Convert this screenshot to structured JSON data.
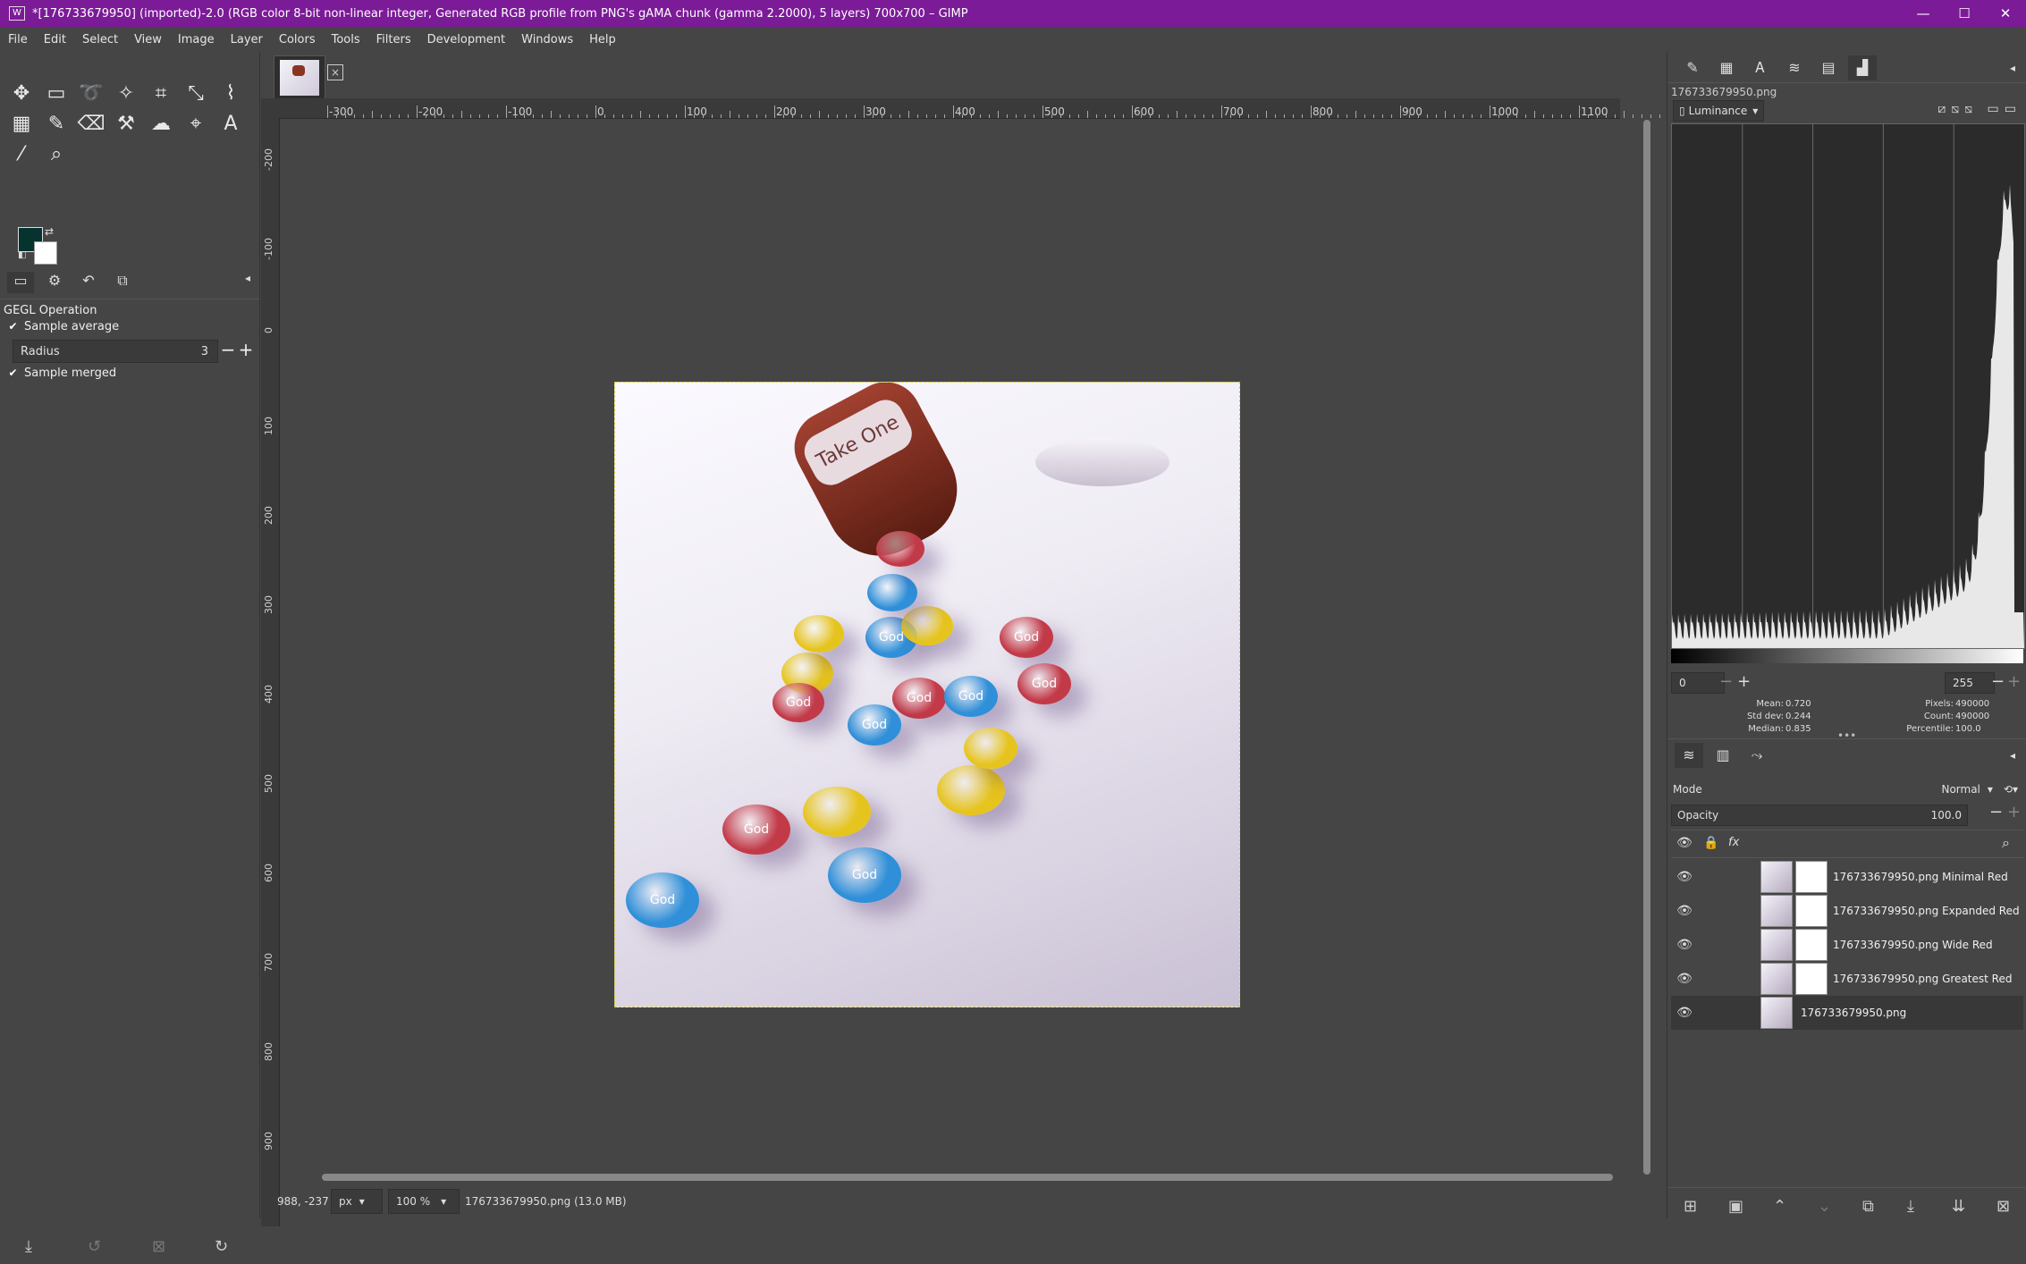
{
  "window": {
    "title": "*[176733679950] (imported)-2.0 (RGB color 8-bit non-linear integer, Generated RGB profile from PNG's gAMA chunk (gamma 2.2000), 5 layers) 700x700 – GIMP",
    "minimize": "—",
    "maximize": "☐",
    "close": "✕"
  },
  "menu": [
    "File",
    "Edit",
    "Select",
    "View",
    "Image",
    "Layer",
    "Colors",
    "Tools",
    "Filters",
    "Development",
    "Windows",
    "Help"
  ],
  "toolbox": {
    "tools": [
      {
        "icon": "move-icon",
        "glyph": "✥"
      },
      {
        "icon": "rect-select-icon",
        "glyph": "▭"
      },
      {
        "icon": "lasso-icon",
        "glyph": "➰"
      },
      {
        "icon": "fuzzy-select-icon",
        "glyph": "✧"
      },
      {
        "icon": "crop-icon",
        "glyph": "⌗"
      },
      {
        "icon": "unified-transform-icon",
        "glyph": "⤡"
      },
      {
        "icon": "warp-icon",
        "glyph": "⌇"
      },
      {
        "icon": "gradient-icon",
        "glyph": "▦"
      },
      {
        "icon": "paintbrush-icon",
        "glyph": "✎"
      },
      {
        "icon": "eraser-icon",
        "glyph": "⌫"
      },
      {
        "icon": "clone-icon",
        "glyph": "⚒"
      },
      {
        "icon": "smudge-icon",
        "glyph": "☁"
      },
      {
        "icon": "paths-icon",
        "glyph": "⌖"
      },
      {
        "icon": "text-icon",
        "glyph": "A"
      },
      {
        "icon": "color-picker-icon",
        "glyph": "⁄"
      },
      {
        "icon": "zoom-icon",
        "glyph": "⌕"
      }
    ],
    "fg_color": "#06322f",
    "bg_color": "#ffffff"
  },
  "tool_options": {
    "title": "GEGL Operation",
    "sample_average": "Sample average",
    "radius_label": "Radius",
    "radius_value": "3",
    "sample_merged": "Sample merged"
  },
  "image_tab": {
    "close": "×"
  },
  "ruler": {
    "h_ticks": [
      "-300",
      "-200",
      "-100",
      "0",
      "100",
      "200",
      "300",
      "400",
      "500",
      "600",
      "700",
      "800",
      "900",
      "1000",
      "1100"
    ],
    "v_ticks": [
      "-200",
      "-100",
      "0",
      "100",
      "200",
      "300",
      "400",
      "500",
      "600",
      "700",
      "800",
      "900"
    ]
  },
  "canvas": {
    "bottle_label": "Take One",
    "candy_text": "God",
    "candies": [
      {
        "color": "#2f8fd8",
        "text": "God"
      },
      {
        "color": "#c23a48",
        "text": "God"
      },
      {
        "color": "#e6c41e",
        "text": ""
      },
      {
        "color": "#2f8fd8",
        "text": "God"
      },
      {
        "color": "#e6c41e",
        "text": ""
      },
      {
        "color": "#c23a48",
        "text": "God"
      },
      {
        "color": "#2f8fd8",
        "text": "God"
      },
      {
        "color": "#e6c41e",
        "text": ""
      },
      {
        "color": "#c23a48",
        "text": "God"
      },
      {
        "color": "#2f8fd8",
        "text": "God"
      },
      {
        "color": "#c23a48",
        "text": "God"
      },
      {
        "color": "#e6c41e",
        "text": ""
      },
      {
        "color": "#2f8fd8",
        "text": "God"
      },
      {
        "color": "#e6c41e",
        "text": ""
      },
      {
        "color": "#c23a48",
        "text": "God"
      },
      {
        "color": "#e6c41e",
        "text": ""
      },
      {
        "color": "#2f8fd8",
        "text": ""
      },
      {
        "color": "#c23a48",
        "text": ""
      }
    ]
  },
  "status": {
    "coords": "988, -237",
    "unit": "px",
    "zoom": "100 %",
    "file": "176733679950.png (13.0 MB)"
  },
  "histogram": {
    "filename": "176733679950.png",
    "channel": "Luminance",
    "range_low": "0",
    "range_high": "255",
    "mean_label": "Mean:",
    "mean": "0.720",
    "stddev_label": "Std dev:",
    "stddev": "0.244",
    "median_label": "Median:",
    "median": "0.835",
    "pixels_label": "Pixels:",
    "pixels": "490000",
    "count_label": "Count:",
    "count": "490000",
    "percentile_label": "Percentile:",
    "percentile": "100.0"
  },
  "layers": {
    "mode_label": "Mode",
    "mode_value": "Normal",
    "opacity_label": "Opacity",
    "opacity_value": "100.0",
    "items": [
      {
        "name": "176733679950.png Minimal Red",
        "has_mask": true
      },
      {
        "name": "176733679950.png Expanded Red",
        "has_mask": true
      },
      {
        "name": "176733679950.png Wide Red",
        "has_mask": true
      },
      {
        "name": "176733679950.png Greatest Red",
        "has_mask": true
      },
      {
        "name": "176733679950.png",
        "has_mask": false
      }
    ]
  }
}
